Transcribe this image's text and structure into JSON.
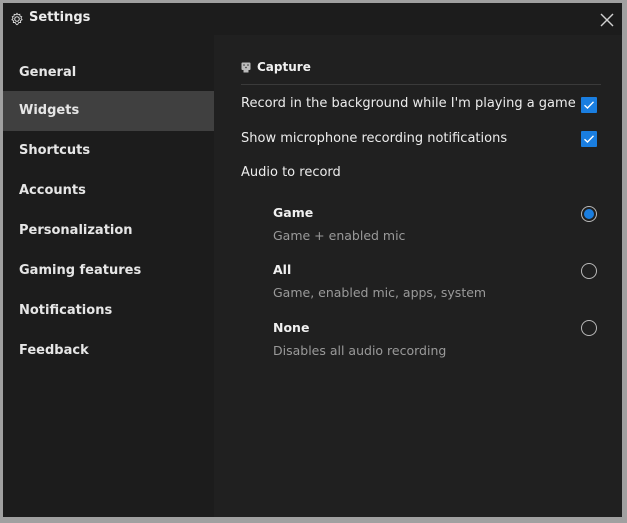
{
  "window": {
    "title": "Settings",
    "icon": "gear-icon",
    "close_icon": "close-icon"
  },
  "sidebar": {
    "items": [
      {
        "label": "General",
        "active": false
      },
      {
        "label": "Widgets",
        "active": true
      },
      {
        "label": "Shortcuts",
        "active": false
      },
      {
        "label": "Accounts",
        "active": false
      },
      {
        "label": "Personalization",
        "active": false
      },
      {
        "label": "Gaming features",
        "active": false
      },
      {
        "label": "Notifications",
        "active": false
      },
      {
        "label": "Feedback",
        "active": false
      }
    ]
  },
  "content": {
    "section": {
      "title": "Capture",
      "icon": "capture-icon"
    },
    "settings": [
      {
        "label": "Record in the background while I'm playing a game",
        "checked": true
      },
      {
        "label": "Show microphone recording notifications",
        "checked": true
      }
    ],
    "audio": {
      "label": "Audio to record",
      "options": [
        {
          "title": "Game",
          "description": "Game + enabled mic",
          "selected": true
        },
        {
          "title": "All",
          "description": "Game, enabled mic, apps, system",
          "selected": false
        },
        {
          "title": "None",
          "description": "Disables all audio recording",
          "selected": false
        }
      ]
    }
  },
  "colors": {
    "accent": "#1a7ee0",
    "active_nav": "#404040"
  }
}
